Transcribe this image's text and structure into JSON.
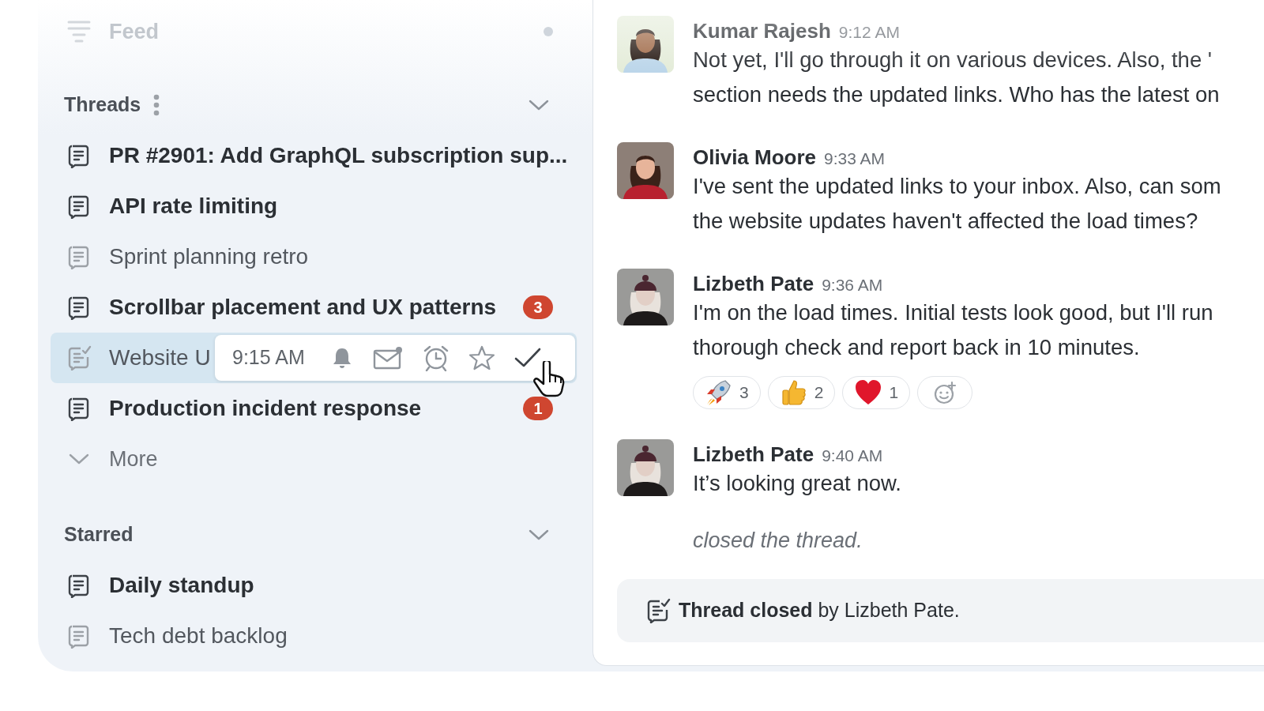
{
  "sidebar": {
    "feed": {
      "label": "Feed",
      "unread": true
    },
    "sections": [
      {
        "title": "Threads",
        "has_menu": true,
        "expanded": true,
        "items": [
          {
            "label": "PR #2901: Add GraphQL subscription sup...",
            "kind": "open",
            "unread": true,
            "selected": false
          },
          {
            "label": "API rate limiting",
            "kind": "open",
            "unread": true,
            "selected": false
          },
          {
            "label": "Sprint planning retro",
            "kind": "open",
            "unread": false,
            "selected": false
          },
          {
            "label": "Scrollbar placement and UX patterns",
            "kind": "open",
            "unread": true,
            "selected": false,
            "badge": "3"
          },
          {
            "label": "Website U",
            "kind": "closed",
            "unread": false,
            "selected": true,
            "hover_toolbar": {
              "time": "9:15 AM"
            }
          },
          {
            "label": "Production incident response",
            "kind": "open",
            "unread": true,
            "selected": false,
            "badge": "1"
          }
        ],
        "more": "More"
      },
      {
        "title": "Starred",
        "has_menu": false,
        "expanded": true,
        "items": [
          {
            "label": "Daily standup",
            "kind": "open",
            "unread": true,
            "selected": false
          },
          {
            "label": "Tech debt backlog",
            "kind": "open",
            "unread": false,
            "selected": false
          }
        ]
      }
    ]
  },
  "messages": [
    {
      "author": "Kumar Rajesh",
      "time": "9:12 AM",
      "lines": [
        "Not yet, I'll go through it on various devices. Also, the '",
        "section needs the updated links. Who has the latest on"
      ]
    },
    {
      "author": "Olivia Moore",
      "time": "9:33 AM",
      "lines": [
        "I've sent the updated links to your inbox. Also, can som",
        "the website updates haven't affected the load times?"
      ]
    },
    {
      "author": "Lizbeth Pate",
      "time": "9:36 AM",
      "lines": [
        "I'm on the load times. Initial tests look good, but I'll run",
        "thorough check and report back in 10 minutes."
      ],
      "reactions": [
        {
          "kind": "rocket",
          "count": "3"
        },
        {
          "kind": "thumbs-up",
          "count": "2"
        },
        {
          "kind": "heart",
          "count": "1"
        }
      ]
    },
    {
      "author": "Lizbeth Pate",
      "time": "9:40 AM",
      "lines": [
        "It’s looking great now."
      ]
    }
  ],
  "event": "closed the thread.",
  "notice": "**Thread closed** by Lizbeth Pate."
}
